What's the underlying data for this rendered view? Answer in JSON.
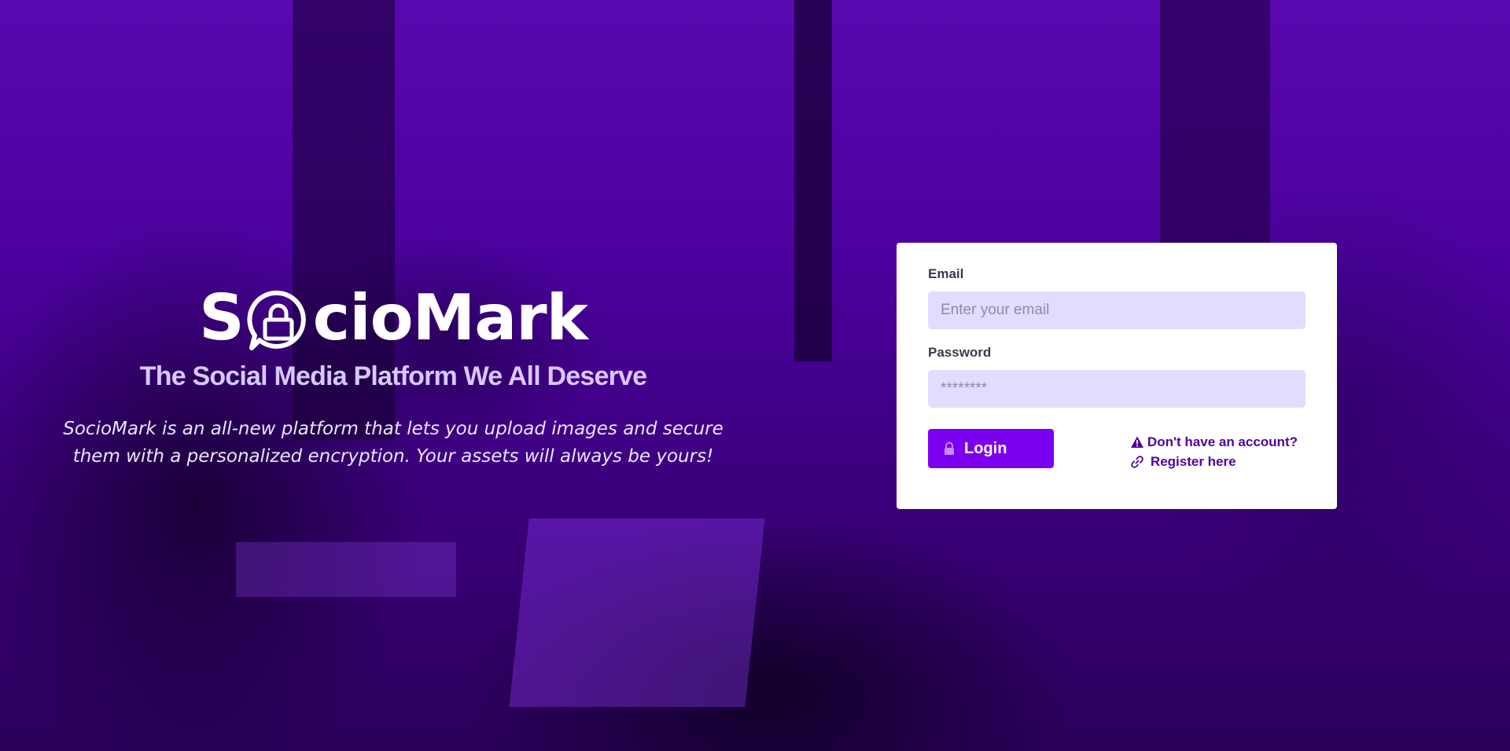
{
  "brand": {
    "name_prefix": "S",
    "name_suffix": "cioMark",
    "logo_icon": "speech-bubble-lock-icon",
    "tagline": "The Social Media Platform We All Deserve",
    "description": "SocioMark is an all-new platform that lets you upload images and secure them with a personalized encryption. Your assets will always be yours!"
  },
  "login_form": {
    "email_label": "Email",
    "email_placeholder": "Enter your email",
    "email_value": "",
    "password_label": "Password",
    "password_placeholder": "********",
    "password_value": "",
    "login_button": "Login",
    "login_icon": "lock-icon",
    "no_account_text": "Don't have an account?",
    "no_account_icon": "warning-icon",
    "register_link": "Register here",
    "register_icon": "link-icon"
  },
  "colors": {
    "accent": "#7b00f0",
    "input_bg": "#e1ddff",
    "link": "#4f02a0",
    "tagline": "#d7c8ff",
    "background_tint": "#4a0099"
  }
}
